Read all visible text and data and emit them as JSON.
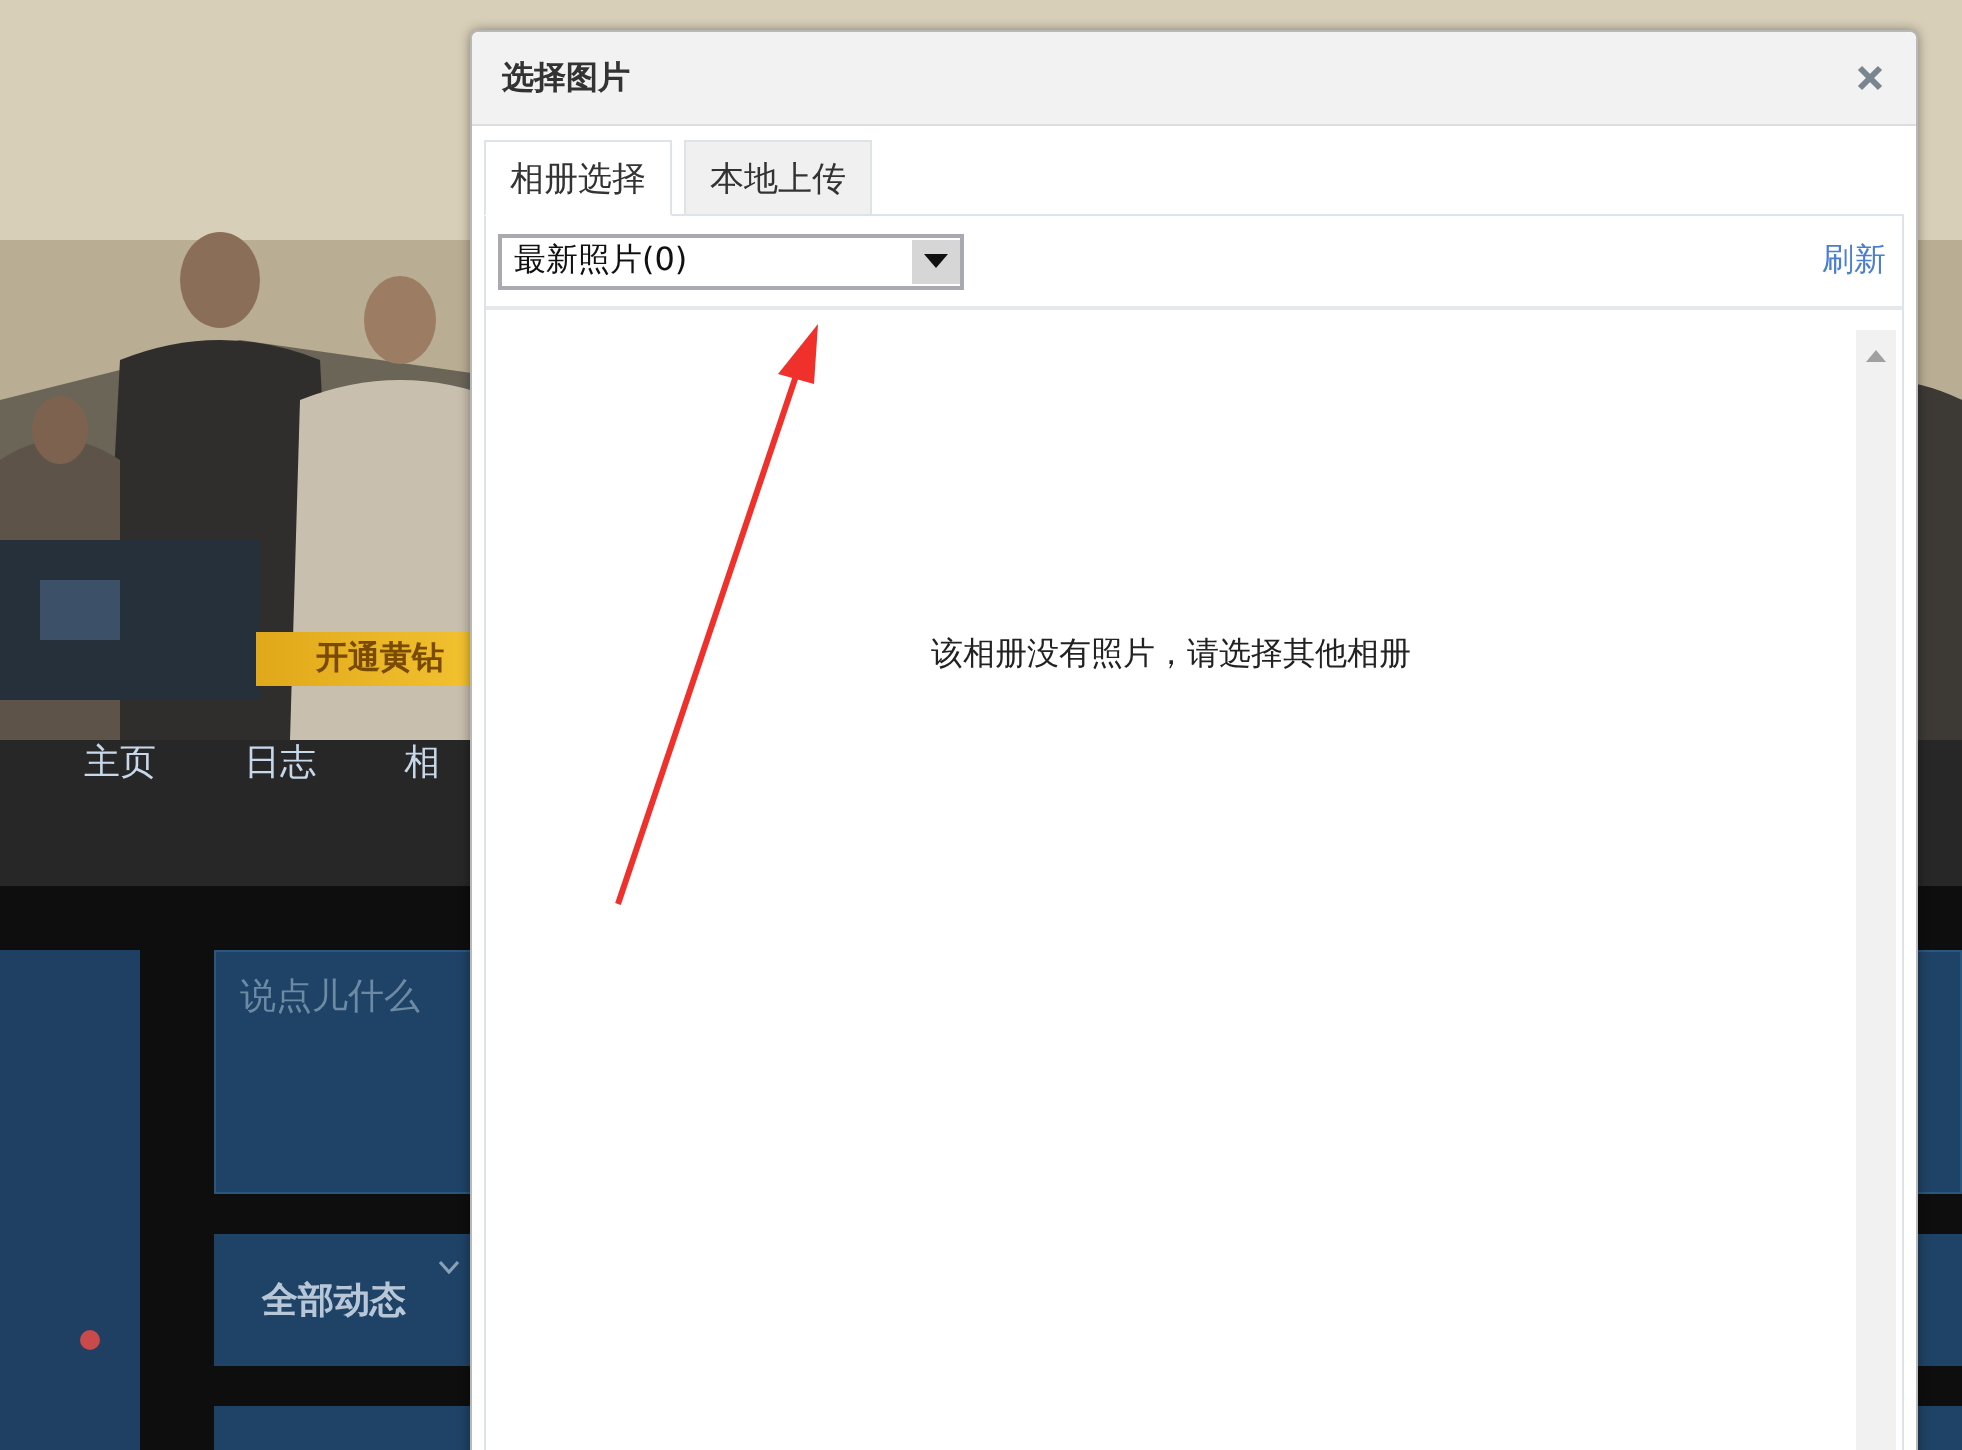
{
  "page": {
    "vip_badge": "开通黄钻",
    "nav": [
      {
        "label": "主页"
      },
      {
        "label": "日志"
      },
      {
        "label": "相"
      }
    ],
    "post_placeholder": "说点儿什么",
    "feed_filter": "全部动态"
  },
  "dialog": {
    "title": "选择图片",
    "tabs": [
      {
        "label": "相册选择",
        "selected": true
      },
      {
        "label": "本地上传",
        "selected": false
      }
    ],
    "album_select": {
      "value": "最新照片(0)"
    },
    "refresh": "刷新",
    "empty_message": "该相册没有照片，请选择其他相册"
  }
}
